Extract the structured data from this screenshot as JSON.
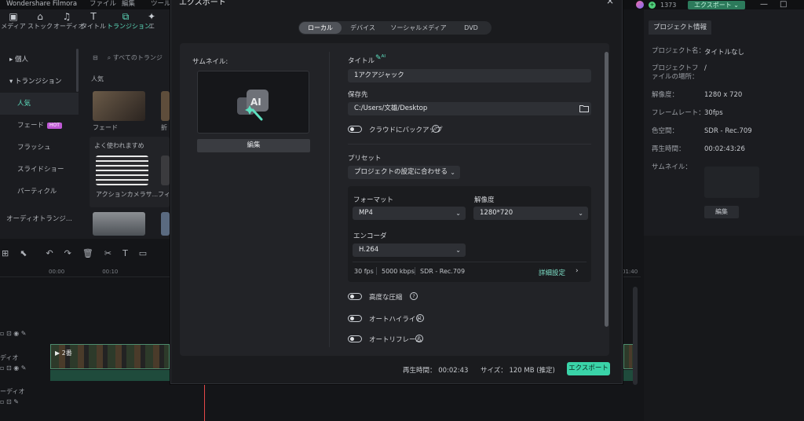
{
  "app": {
    "title": "Wondershare Filmora",
    "menu": [
      "ファイル",
      "編集",
      "ツール"
    ],
    "coins": "1373",
    "export_label": "エクスポート ⌄"
  },
  "toolbar": [
    {
      "icon": "media-icon",
      "glyph": "▣",
      "label": "メディア"
    },
    {
      "icon": "stock-icon",
      "glyph": "⌂",
      "label": "ストック"
    },
    {
      "icon": "audio-icon",
      "glyph": "♫",
      "label": "オーディオ"
    },
    {
      "icon": "title-icon",
      "glyph": "T",
      "label": "タイトル"
    },
    {
      "icon": "transition-icon",
      "glyph": "⧉",
      "label": "トランジション"
    },
    {
      "icon": "effect-icon",
      "glyph": "✦",
      "label": "エ"
    }
  ],
  "categories": {
    "personal": "▸ 個人",
    "transition": "▾ トランジション",
    "items": [
      {
        "label": "人気",
        "selected": true
      },
      {
        "label": "フェード",
        "badge": "HOT"
      },
      {
        "label": "フラッシュ"
      },
      {
        "label": "スライドショー"
      },
      {
        "label": "パーティクル"
      }
    ],
    "footer": "オーディオトランジ..."
  },
  "library": {
    "search_placeholder": "すべてのトランジ",
    "section_popular": "人気",
    "section_recommended": "よく使われますめ",
    "thumb1": "フェード",
    "thumb2": "折",
    "thumb3": "アクションカメラサ...",
    "thumb4": "フィ"
  },
  "timeline": {
    "ruler": [
      "00:00",
      "00:10",
      "01:40"
    ],
    "clip_label": "2番",
    "track_labels": [
      "ディオ",
      "ーディオ"
    ]
  },
  "project": {
    "tab": "プロジェクト情報",
    "rows": [
      {
        "label": "プロジェクト名：",
        "value": "タイトルなし"
      },
      {
        "label": "プロジェクトファイルの場所：",
        "value": "/"
      },
      {
        "label": "解像度：",
        "value": "1280 x 720"
      },
      {
        "label": "フレームレート：",
        "value": "30fps"
      },
      {
        "label": "色空間：",
        "value": "SDR - Rec.709"
      },
      {
        "label": "再生時間：",
        "value": "00:02:43:26"
      },
      {
        "label": "サムネイル：",
        "value": ""
      }
    ],
    "edit_button": "編集"
  },
  "dialog": {
    "title": "エクスポート",
    "close": "×",
    "tabs": [
      {
        "label": "ローカル",
        "active": true
      },
      {
        "label": "デバイス",
        "active": false
      },
      {
        "label": "ソーシャルメディア",
        "active": false
      },
      {
        "label": "DVD",
        "active": false
      }
    ],
    "thumbnail_label": "サムネイル:",
    "edit_button": "編集",
    "title_label": "タイトル",
    "title_value": "1アクアジャック",
    "save_label": "保存先",
    "save_value": "C:/Users/文雄/Desktop",
    "cloud_backup": "クラウドにバックアップ",
    "preset_label": "プリセット",
    "preset_value": "プロジェクトの設定に合わせる",
    "format_label": "フォーマット",
    "format_value": "MP4",
    "resolution_label": "解像度",
    "resolution_value": "1280*720",
    "encoder_label": "エンコーダ",
    "encoder_value": "H.264",
    "spec_fps": "30 fps",
    "spec_bitrate": "5000 kbps",
    "spec_color": "SDR - Rec.709",
    "detail_settings": "詳細設定",
    "advanced_compression": "高度な圧縮",
    "auto_highlight": "オートハイライト",
    "auto_reframe": "オートリフレーム",
    "duration_label": "再生時間：",
    "duration_value": "00:02:43",
    "size_label": "サイズ：",
    "size_value": "120 MB (推定)",
    "export_button": "エクスポート",
    "accent": "#3ad3a8"
  }
}
